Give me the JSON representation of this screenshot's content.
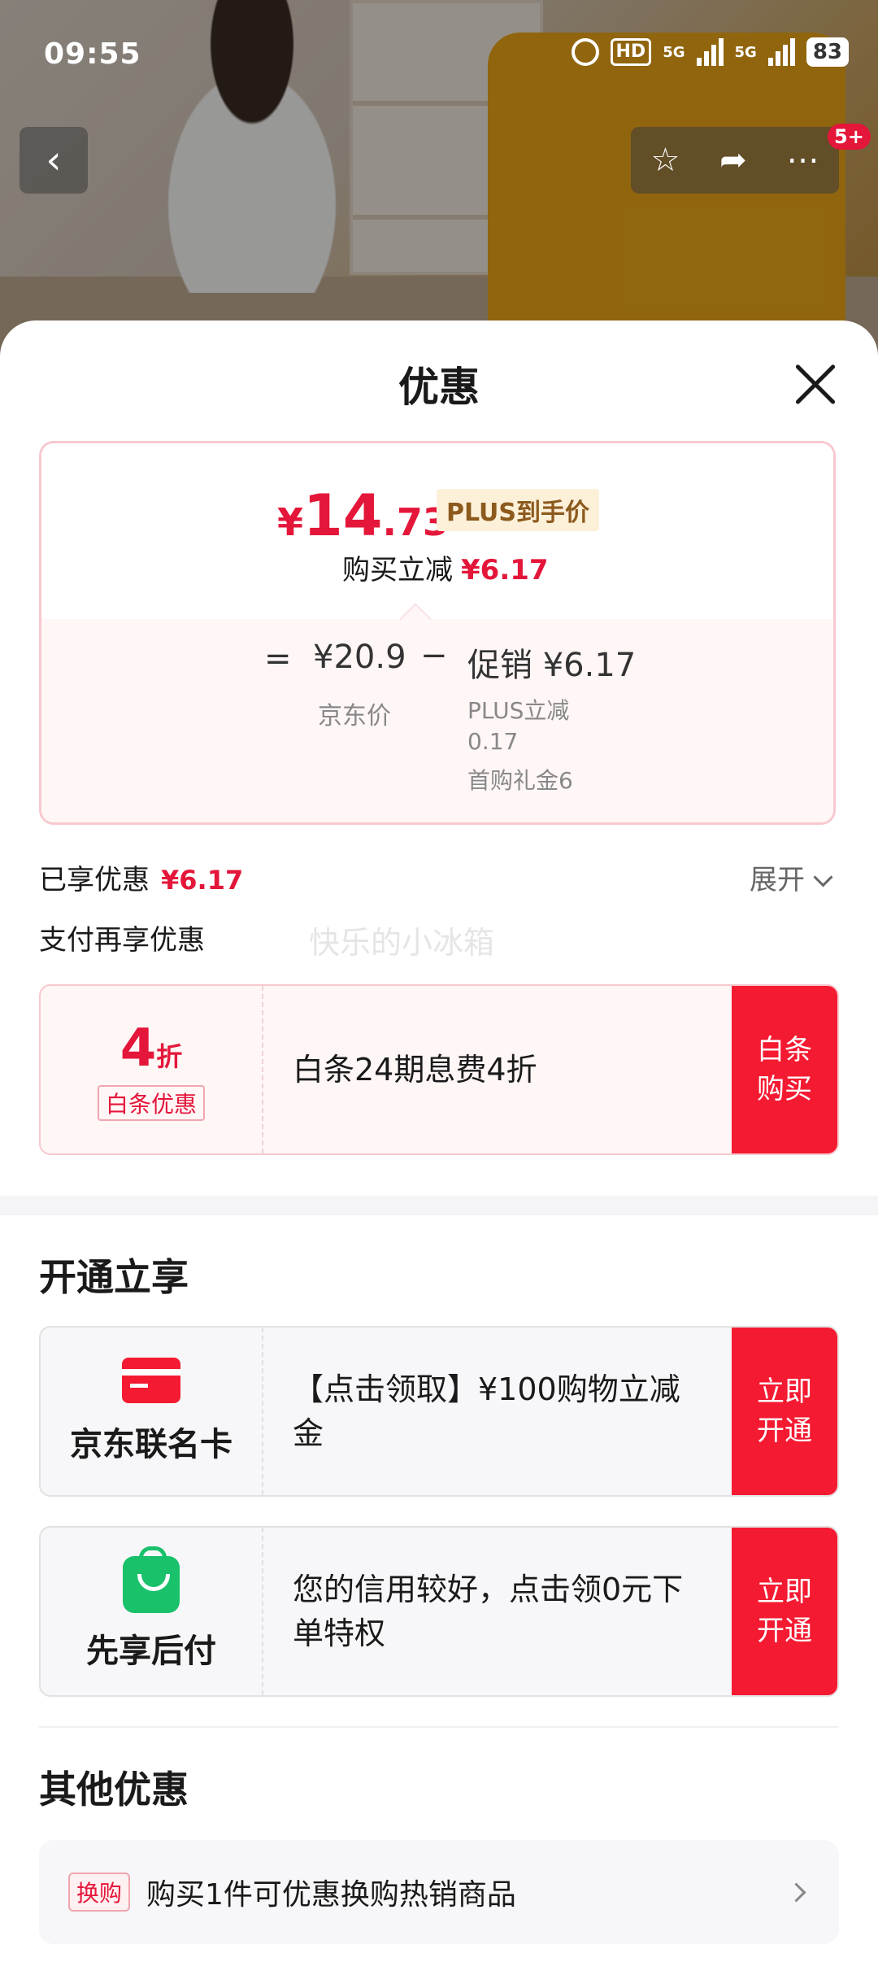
{
  "status_bar": {
    "time": "09:55",
    "hd": "HD",
    "battery": "83",
    "net1": "5G",
    "net2": "5G"
  },
  "hero": {
    "back_icon": "chevron-left-icon",
    "badge": "5+"
  },
  "sheet": {
    "title": "优惠"
  },
  "price_card": {
    "currency": "¥",
    "final_int": "14",
    "final_dec": ".73",
    "plus_tag": "PLUS到手价",
    "buy_reduce_label": "购买立减",
    "buy_reduce_value": "¥6.17",
    "eq": "=",
    "jd_price": "¥20.9",
    "jd_label": "京东价",
    "minus": "−",
    "promo": "促销 ¥6.17",
    "promo_item1_line1": "PLUS立减",
    "promo_item1_line2": "0.17",
    "promo_item2": "首购礼金6"
  },
  "enjoyed": {
    "label": "已享优惠",
    "value": "¥6.17",
    "expand": "展开"
  },
  "pay_more": {
    "label": "支付再享优惠",
    "watermark": "快乐的小冰箱"
  },
  "baitiao": {
    "disc_num": "4",
    "disc_unit": "折",
    "tag": "白条优惠",
    "text": "白条24期息费4折",
    "btn_line1": "白条",
    "btn_line2": "购买"
  },
  "open_section": {
    "title": "开通立享",
    "items": [
      {
        "label": "京东联名卡",
        "text": "【点击领取】¥100购物立减金",
        "btn_line1": "立即",
        "btn_line2": "开通"
      },
      {
        "label": "先享后付",
        "text": "您的信用较好，点击领0元下单特权",
        "btn_line1": "立即",
        "btn_line2": "开通"
      }
    ]
  },
  "other_section": {
    "title": "其他优惠",
    "tag": "换购",
    "text": "购买1件可优惠换购热销商品"
  },
  "colors": {
    "accent": "#f41a31",
    "pink_bg": "#fff6f6",
    "gold": "#8c5a1d",
    "green": "#19c16a"
  }
}
